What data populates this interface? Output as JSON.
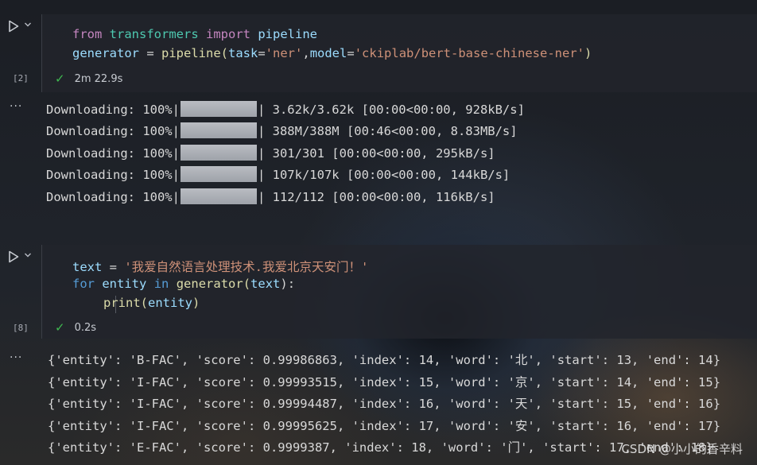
{
  "cell1": {
    "exec_count": "[2]",
    "code": {
      "line1": {
        "kw_from": "from",
        "module": "transformers",
        "kw_import": "import",
        "name": "pipeline"
      },
      "line2": {
        "var": "generator",
        "eq": " = ",
        "fn": "pipeline",
        "open": "(",
        "arg1": "task",
        "eq1": "=",
        "val1": "'ner'",
        "comma": ",",
        "arg2": "model",
        "eq2": "=",
        "val2": "'ckiplab/bert-base-chinese-ner'",
        "close": ")"
      }
    },
    "status_time": "2m 22.9s",
    "output_more": "···",
    "output_lines": [
      {
        "prefix": "Downloading: 100%|",
        "suffix": "| 3.62k/3.62k [00:00<00:00, 928kB/s]",
        "progress": 1.0
      },
      {
        "prefix": "Downloading: 100%|",
        "suffix": "| 388M/388M [00:46<00:00, 8.83MB/s]",
        "progress": 1.0
      },
      {
        "prefix": "Downloading: 100%|",
        "suffix": "| 301/301 [00:00<00:00, 295kB/s]",
        "progress": 1.0
      },
      {
        "prefix": "Downloading: 100%|",
        "suffix": "| 107k/107k [00:00<00:00, 144kB/s]",
        "progress": 1.0
      },
      {
        "prefix": "Downloading: 100%|",
        "suffix": "| 112/112 [00:00<00:00, 116kB/s]",
        "progress": 1.0
      }
    ]
  },
  "cell2": {
    "exec_count": "[8]",
    "code": {
      "line1": {
        "var": "text",
        "eq": " = ",
        "str": "'我爱自然语言处理技术.我爱北京天安门！'"
      },
      "line2": {
        "kw_for": "for",
        "var": "entity",
        "kw_in": "in",
        "fn": "generator",
        "open": "(",
        "arg": "text",
        "close": "):"
      },
      "line3": {
        "fn": "print",
        "open": "(",
        "arg": "entity",
        "close": ")"
      }
    },
    "status_time": "0.2s",
    "output_more": "···",
    "output_lines": [
      "{'entity': 'B-FAC', 'score': 0.99986863, 'index': 14, 'word': '北', 'start': 13, 'end': 14}",
      "{'entity': 'I-FAC', 'score': 0.99993515, 'index': 15, 'word': '京', 'start': 14, 'end': 15}",
      "{'entity': 'I-FAC', 'score': 0.99994487, 'index': 16, 'word': '天', 'start': 15, 'end': 16}",
      "{'entity': 'I-FAC', 'score': 0.99995625, 'index': 17, 'word': '安', 'start': 16, 'end': 17}",
      "{'entity': 'E-FAC', 'score': 0.9999387, 'index': 18, 'word': '门', 'start': 17, 'end': 18}"
    ]
  },
  "watermark": "CSDN @小小的香辛料",
  "colors": {
    "check": "#3fb950",
    "keyword": "#c586c0",
    "string": "#ce9178",
    "function": "#dcdcaa",
    "variable": "#9cdcfe",
    "module": "#4ec9b0"
  }
}
